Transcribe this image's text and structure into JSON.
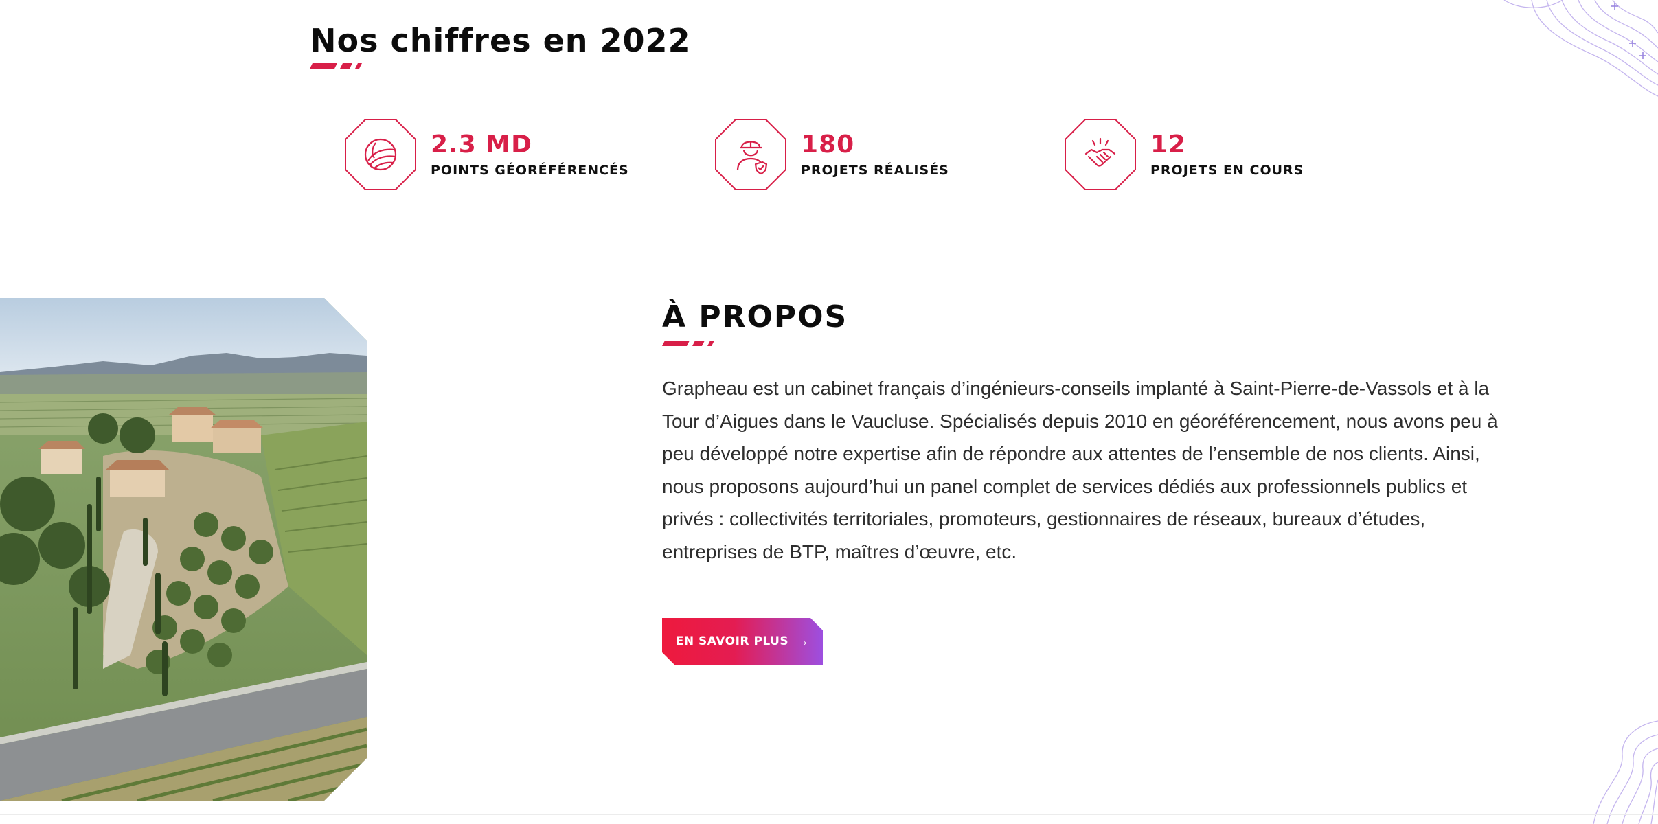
{
  "stats_section": {
    "title": "Nos chiffres en 2022",
    "items": [
      {
        "value": "2.3 MD",
        "label": "POINTS GÉORÉFÉRENCÉS",
        "icon": "survey-points-icon"
      },
      {
        "value": "180",
        "label": "PROJETS RÉALISÉS",
        "icon": "engineer-worker-icon"
      },
      {
        "value": "12",
        "label": "PROJETS EN COURS",
        "icon": "handshake-icon"
      }
    ]
  },
  "about_section": {
    "title": "À PROPOS",
    "body": "Grapheau est un cabinet français d’ingénieurs-conseils implanté à Saint-Pierre-de-Vassols et à la Tour d’Aigues dans le Vaucluse. Spécialisés depuis 2010 en géoréférencement, nous avons peu à peu développé notre expertise afin de répondre aux attentes de l’ensemble de nos clients. Ainsi, nous proposons aujourd’hui un panel complet de services dédiés aux professionnels publics et privés : collectivités territoriales, promoteurs, gestionnaires de réseaux, bureaux d’études, entreprises de BTP, maîtres d’œuvre, etc.",
    "cta_label": "EN SAVOIR PLUS",
    "cta_icon": "arrow-right-icon",
    "image_subject": "aerial-vineyard-farmhouse-photo"
  },
  "colors": {
    "accent_red": "#d81f48",
    "button_gradient_start": "#ee1a3d",
    "button_gradient_end": "#9d4fe0",
    "decoration_purple": "#b7a4ea"
  }
}
